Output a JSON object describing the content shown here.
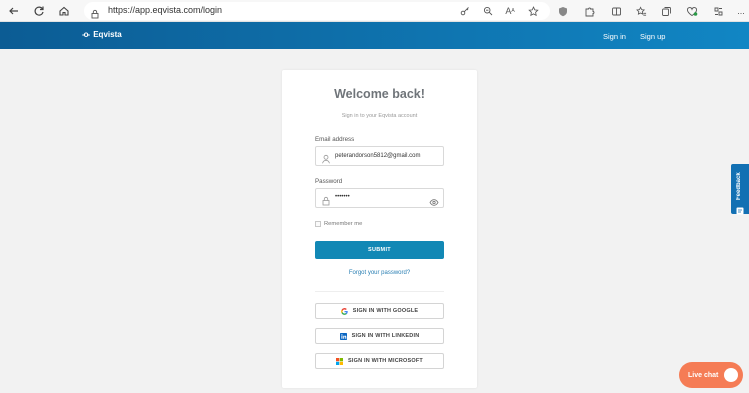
{
  "browser": {
    "url": "https://app.eqvista.com/login",
    "icons": [
      "back-icon",
      "refresh-icon",
      "home-icon",
      "lock-icon",
      "key-icon",
      "zoom-icon",
      "read-aloud-icon",
      "favorite-icon",
      "shield-icon",
      "extension-icon",
      "split-screen-icon",
      "favorites-bar-icon",
      "collections-icon",
      "performance-icon",
      "copilot-icon",
      "more-icon"
    ],
    "aa_text": "A",
    "more_text": "..."
  },
  "header": {
    "logo_mark": "-o-",
    "brand": "Eqvista",
    "sign_in": "Sign in",
    "sign_up": "Sign up"
  },
  "login": {
    "title": "Welcome back!",
    "subtitle": "Sign in to your Eqvista account",
    "email_label": "Email address",
    "email_value": "peterandorson5812@gmail.com",
    "password_label": "Password",
    "password_value": "•••••••",
    "remember_label": "Remember me",
    "submit_label": "SUBMIT",
    "forgot_label": "Forgot your password?",
    "google_label": "SIGN IN WITH GOOGLE",
    "linkedin_label": "SIGN IN WITH LINKEDIN",
    "microsoft_label": "SIGN IN WITH MICROSOFT"
  },
  "widgets": {
    "feedback_label": "Feedback",
    "livechat_label": "Live chat"
  },
  "colors": {
    "header_start": "#0c5c94",
    "header_end": "#1186c4",
    "submit": "#1288b5",
    "livechat": "#f57c55",
    "feedback": "#1270b3"
  }
}
